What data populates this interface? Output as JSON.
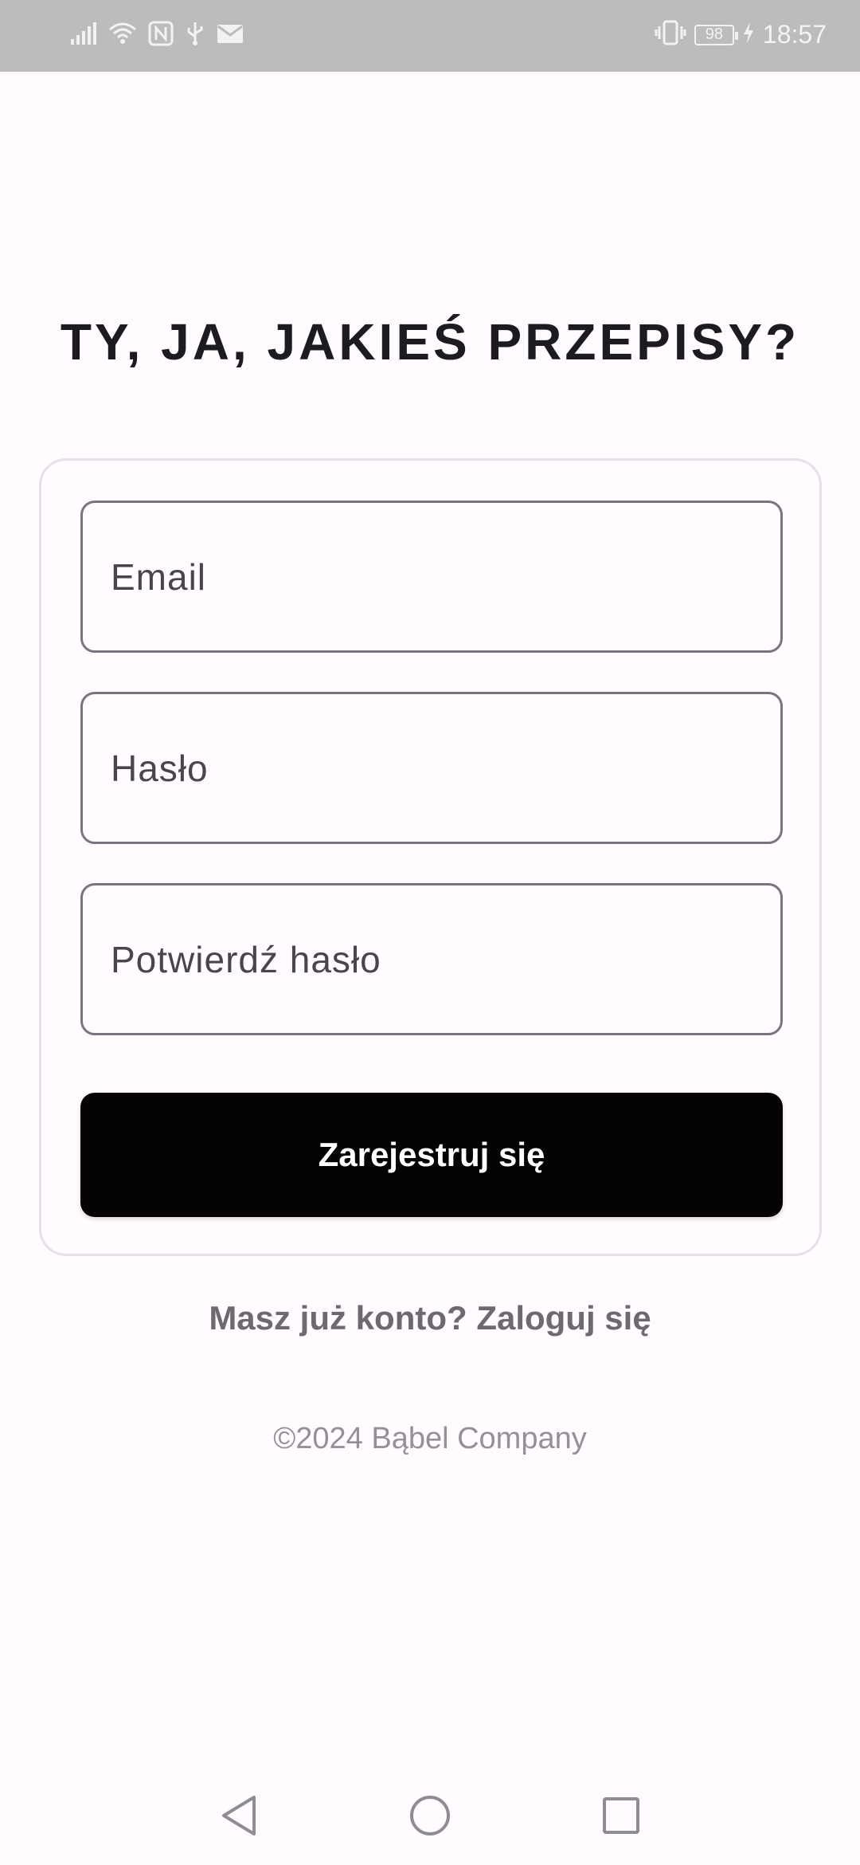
{
  "status_bar": {
    "time": "18:57",
    "battery": "98",
    "icons": [
      "signal-icon",
      "wifi-icon",
      "nfc-icon",
      "usb-icon",
      "mail-icon",
      "vibrate-icon",
      "battery-icon",
      "charging-icon"
    ]
  },
  "page": {
    "title": "TY, JA, JAKIEŚ PRZEPISY?"
  },
  "form": {
    "email_placeholder": "Email",
    "password_placeholder": "Hasło",
    "confirm_placeholder": "Potwierdź hasło",
    "submit_label": "Zarejestruj się"
  },
  "login_link": "Masz już konto? Zaloguj się",
  "footer": "©2024 Bąbel Company",
  "nav": {
    "icons": [
      "back-icon",
      "home-icon",
      "recents-icon"
    ]
  },
  "colors": {
    "background": "#fffbfe",
    "status_bar": "#bdbcbd",
    "button": "#050206",
    "outline": "#79747e"
  }
}
